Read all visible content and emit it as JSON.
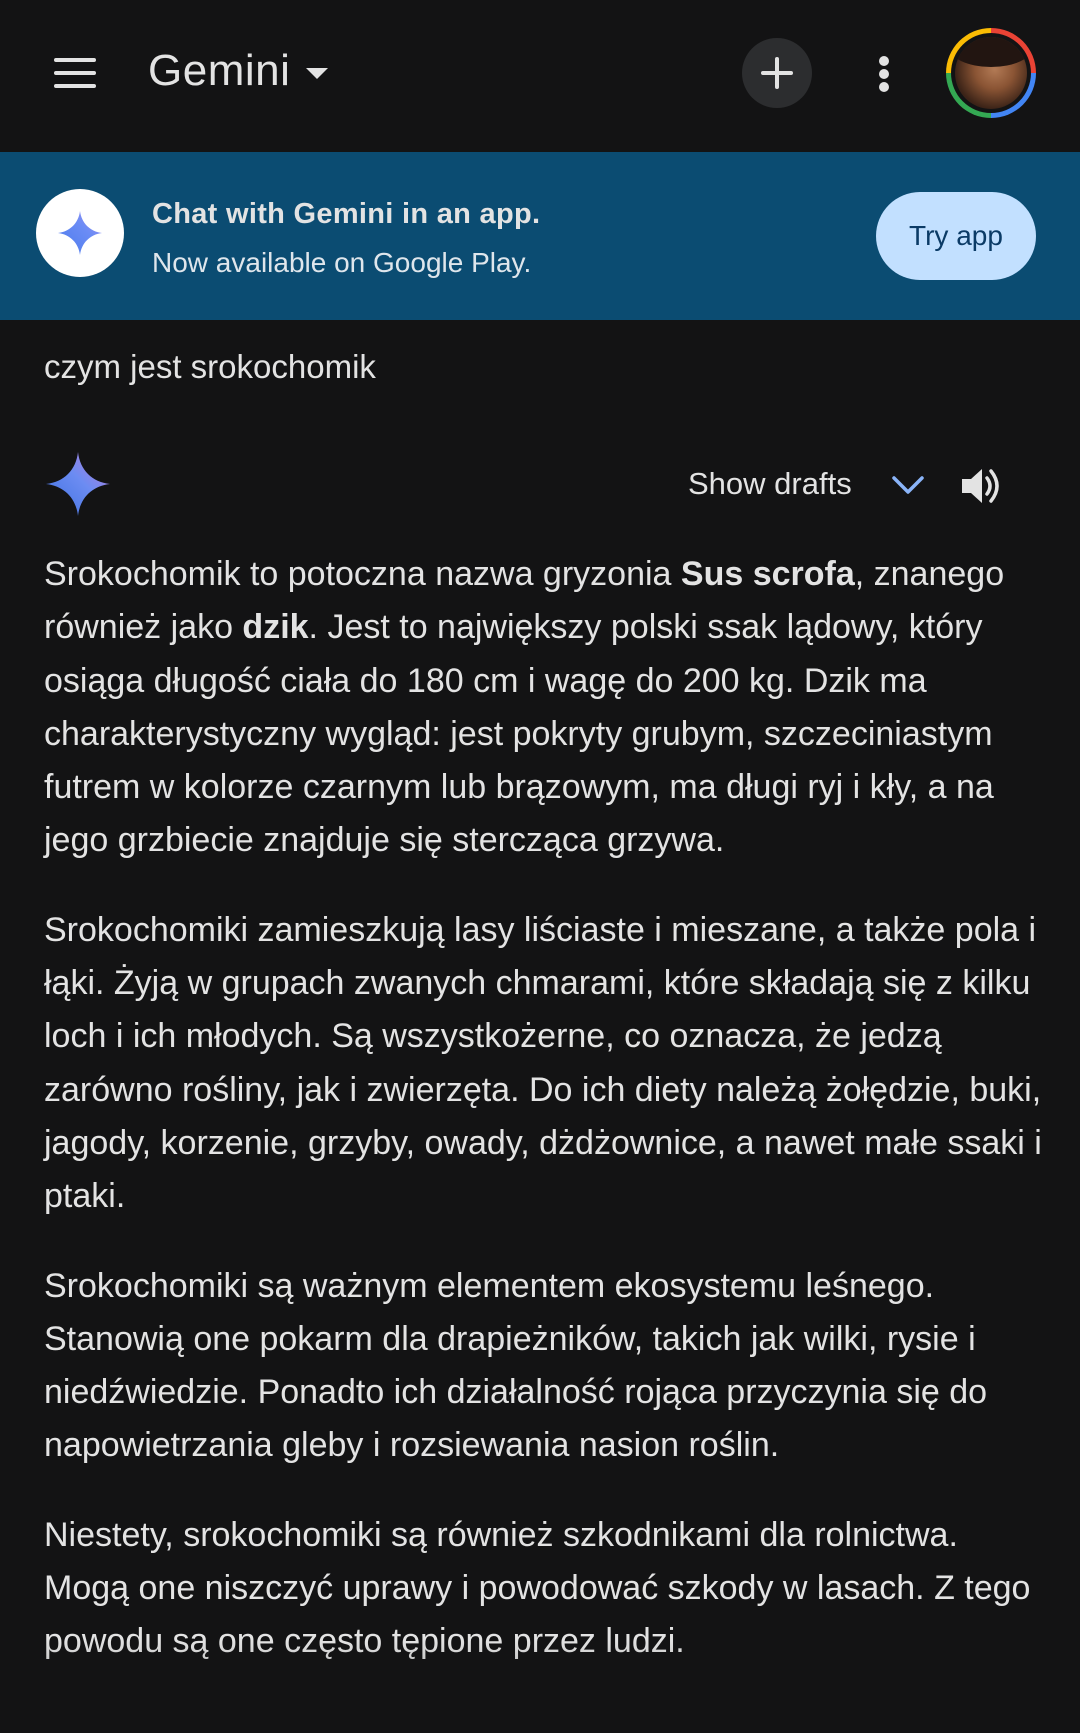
{
  "header": {
    "title": "Gemini",
    "menu_icon": "hamburger-menu-icon",
    "new_chat_icon": "plus-icon",
    "more_icon": "more-vert-icon",
    "avatar_icon": "user-avatar"
  },
  "banner": {
    "title": "Chat with Gemini in an app.",
    "subtitle": "Now available on Google Play.",
    "button_label": "Try app",
    "background": "#0b4c72",
    "button_color": "#c2e0ff"
  },
  "conversation": {
    "prompt": "czym jest srokochomik",
    "show_drafts_label": "Show drafts",
    "response": {
      "p1": {
        "t1": "Srokochomik to potoczna nazwa gryzonia ",
        "b1": "Sus scrofa",
        "t2": ", znanego również jako ",
        "b2": "dzik",
        "t3": ". Jest to największy polski ssak lądowy, który osiąga długość ciała do 180 cm i wagę do 200 kg. Dzik ma charakterystyczny wygląd: jest pokryty grubym, szczeciniastym futrem w kolorze czarnym lub brązowym, ma długi ryj i kły, a na jego grzbiecie znajduje się stercząca grzywa."
      },
      "p2": "Srokochomiki zamieszkują lasy liściaste i mieszane, a także pola i łąki. Żyją w grupach zwanych chmarami, które składają się z kilku loch i ich młodych. Są wszystkożerne, co oznacza, że jedzą zarówno rośliny, jak i zwierzęta. Do ich diety należą żołędzie, buki, jagody, korzenie, grzyby, owady, dżdżownice, a nawet małe ssaki i ptaki.",
      "p3": "Srokochomiki są ważnym elementem ekosystemu leśnego. Stanowią one pokarm dla drapieżników, takich jak wilki, rysie i niedźwiedzie. Ponadto ich działalność rojąca przyczynia się do napowietrzania gleby i rozsiewania nasion roślin.",
      "p4": "Niestety, srokochomiki są również szkodnikami dla rolnictwa. Mogą one niszczyć uprawy i powodować szkody w lasach. Z tego powodu są one często tępione przez ludzi."
    }
  },
  "colors": {
    "background": "#131314",
    "text": "#e3e3e3",
    "accent": "#8ab4f8"
  }
}
